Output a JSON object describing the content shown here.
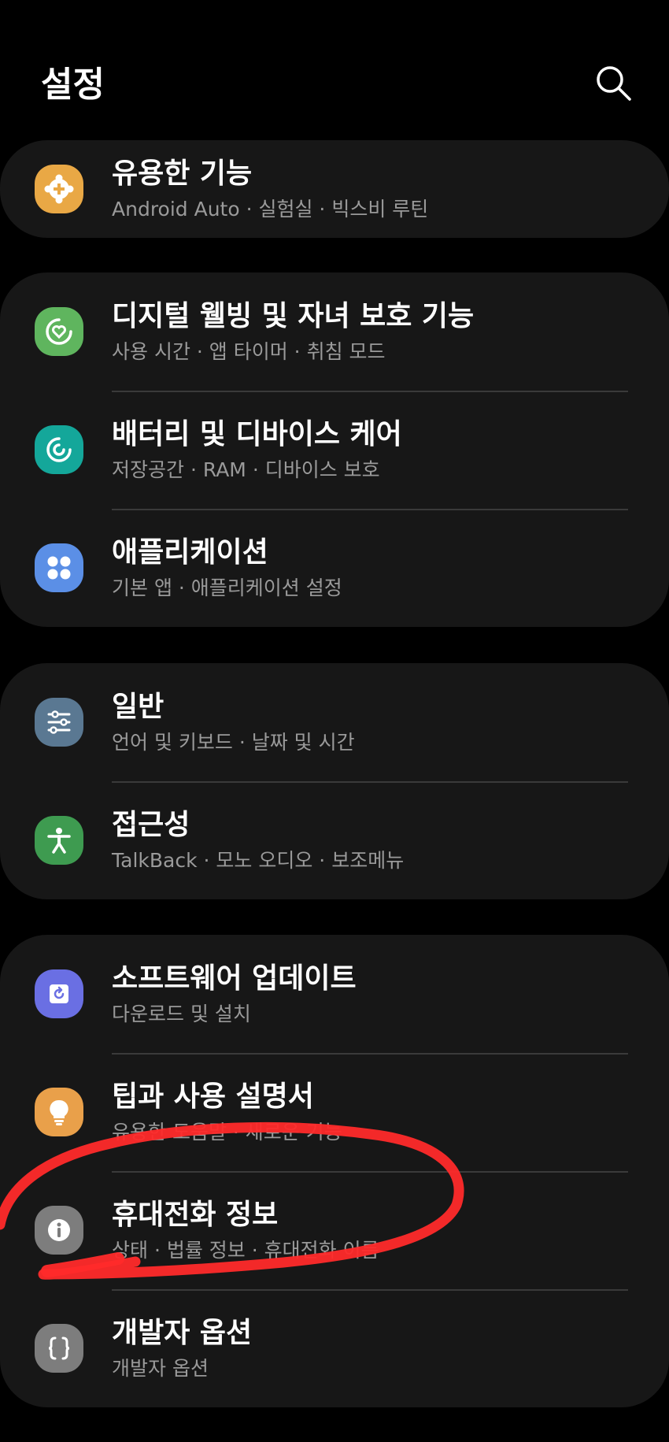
{
  "header": {
    "title": "설정",
    "search_icon": "search-icon"
  },
  "colors": {
    "background": "#000000",
    "card": "#171717",
    "annotation_stroke": "#ff2a2a"
  },
  "groups": [
    {
      "items": [
        {
          "label": "유용한 기능",
          "subtitle": "Android Auto · 실험실 · 빅스비 루틴",
          "icon": "plus-gear-icon",
          "icon_color": "#e9a845"
        }
      ]
    },
    {
      "items": [
        {
          "label": "디지털 웰빙 및 자녀 보호 기능",
          "subtitle": "사용 시간 · 앱 타이머 · 취침 모드",
          "icon": "heart-circle-icon",
          "icon_color": "#5fb55e"
        },
        {
          "label": "배터리 및 디바이스 케어",
          "subtitle": "저장공간 · RAM · 디바이스 보호",
          "icon": "device-care-icon",
          "icon_color": "#14a79a"
        },
        {
          "label": "애플리케이션",
          "subtitle": "기본 앱 · 애플리케이션 설정",
          "icon": "apps-grid-icon",
          "icon_color": "#5b8fe6"
        }
      ]
    },
    {
      "items": [
        {
          "label": "일반",
          "subtitle": "언어 및 키보드 · 날짜 및 시간",
          "icon": "sliders-icon",
          "icon_color": "#5a7892"
        },
        {
          "label": "접근성",
          "subtitle": "TalkBack · 모노 오디오 · 보조메뉴",
          "icon": "accessibility-icon",
          "icon_color": "#3e9b50"
        }
      ]
    },
    {
      "items": [
        {
          "label": "소프트웨어 업데이트",
          "subtitle": "다운로드 및 설치",
          "icon": "update-icon",
          "icon_color": "#6a6fe3"
        },
        {
          "label": "팁과 사용 설명서",
          "subtitle": "유용한 도움말 · 새로운 기능",
          "icon": "lightbulb-icon",
          "icon_color": "#e9a04a"
        },
        {
          "label": "휴대전화 정보",
          "subtitle": "상태 · 법률 정보 · 휴대전화 이름",
          "icon": "info-icon",
          "icon_color": "#7d7d7d"
        },
        {
          "label": "개발자 옵션",
          "subtitle": "개발자 옵션",
          "icon": "braces-icon",
          "icon_color": "#7d7d7d"
        }
      ]
    }
  ]
}
